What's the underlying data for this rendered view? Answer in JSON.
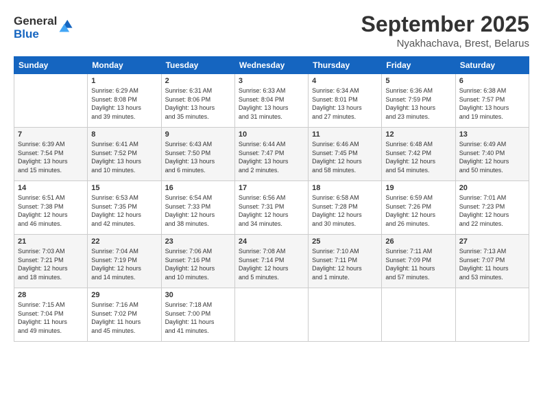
{
  "logo": {
    "general": "General",
    "blue": "Blue"
  },
  "title": "September 2025",
  "location": "Nyakhachava, Brest, Belarus",
  "days_header": [
    "Sunday",
    "Monday",
    "Tuesday",
    "Wednesday",
    "Thursday",
    "Friday",
    "Saturday"
  ],
  "weeks": [
    [
      {
        "day": "",
        "text": ""
      },
      {
        "day": "1",
        "text": "Sunrise: 6:29 AM\nSunset: 8:08 PM\nDaylight: 13 hours\nand 39 minutes."
      },
      {
        "day": "2",
        "text": "Sunrise: 6:31 AM\nSunset: 8:06 PM\nDaylight: 13 hours\nand 35 minutes."
      },
      {
        "day": "3",
        "text": "Sunrise: 6:33 AM\nSunset: 8:04 PM\nDaylight: 13 hours\nand 31 minutes."
      },
      {
        "day": "4",
        "text": "Sunrise: 6:34 AM\nSunset: 8:01 PM\nDaylight: 13 hours\nand 27 minutes."
      },
      {
        "day": "5",
        "text": "Sunrise: 6:36 AM\nSunset: 7:59 PM\nDaylight: 13 hours\nand 23 minutes."
      },
      {
        "day": "6",
        "text": "Sunrise: 6:38 AM\nSunset: 7:57 PM\nDaylight: 13 hours\nand 19 minutes."
      }
    ],
    [
      {
        "day": "7",
        "text": "Sunrise: 6:39 AM\nSunset: 7:54 PM\nDaylight: 13 hours\nand 15 minutes."
      },
      {
        "day": "8",
        "text": "Sunrise: 6:41 AM\nSunset: 7:52 PM\nDaylight: 13 hours\nand 10 minutes."
      },
      {
        "day": "9",
        "text": "Sunrise: 6:43 AM\nSunset: 7:50 PM\nDaylight: 13 hours\nand 6 minutes."
      },
      {
        "day": "10",
        "text": "Sunrise: 6:44 AM\nSunset: 7:47 PM\nDaylight: 13 hours\nand 2 minutes."
      },
      {
        "day": "11",
        "text": "Sunrise: 6:46 AM\nSunset: 7:45 PM\nDaylight: 12 hours\nand 58 minutes."
      },
      {
        "day": "12",
        "text": "Sunrise: 6:48 AM\nSunset: 7:42 PM\nDaylight: 12 hours\nand 54 minutes."
      },
      {
        "day": "13",
        "text": "Sunrise: 6:49 AM\nSunset: 7:40 PM\nDaylight: 12 hours\nand 50 minutes."
      }
    ],
    [
      {
        "day": "14",
        "text": "Sunrise: 6:51 AM\nSunset: 7:38 PM\nDaylight: 12 hours\nand 46 minutes."
      },
      {
        "day": "15",
        "text": "Sunrise: 6:53 AM\nSunset: 7:35 PM\nDaylight: 12 hours\nand 42 minutes."
      },
      {
        "day": "16",
        "text": "Sunrise: 6:54 AM\nSunset: 7:33 PM\nDaylight: 12 hours\nand 38 minutes."
      },
      {
        "day": "17",
        "text": "Sunrise: 6:56 AM\nSunset: 7:31 PM\nDaylight: 12 hours\nand 34 minutes."
      },
      {
        "day": "18",
        "text": "Sunrise: 6:58 AM\nSunset: 7:28 PM\nDaylight: 12 hours\nand 30 minutes."
      },
      {
        "day": "19",
        "text": "Sunrise: 6:59 AM\nSunset: 7:26 PM\nDaylight: 12 hours\nand 26 minutes."
      },
      {
        "day": "20",
        "text": "Sunrise: 7:01 AM\nSunset: 7:23 PM\nDaylight: 12 hours\nand 22 minutes."
      }
    ],
    [
      {
        "day": "21",
        "text": "Sunrise: 7:03 AM\nSunset: 7:21 PM\nDaylight: 12 hours\nand 18 minutes."
      },
      {
        "day": "22",
        "text": "Sunrise: 7:04 AM\nSunset: 7:19 PM\nDaylight: 12 hours\nand 14 minutes."
      },
      {
        "day": "23",
        "text": "Sunrise: 7:06 AM\nSunset: 7:16 PM\nDaylight: 12 hours\nand 10 minutes."
      },
      {
        "day": "24",
        "text": "Sunrise: 7:08 AM\nSunset: 7:14 PM\nDaylight: 12 hours\nand 5 minutes."
      },
      {
        "day": "25",
        "text": "Sunrise: 7:10 AM\nSunset: 7:11 PM\nDaylight: 12 hours\nand 1 minute."
      },
      {
        "day": "26",
        "text": "Sunrise: 7:11 AM\nSunset: 7:09 PM\nDaylight: 11 hours\nand 57 minutes."
      },
      {
        "day": "27",
        "text": "Sunrise: 7:13 AM\nSunset: 7:07 PM\nDaylight: 11 hours\nand 53 minutes."
      }
    ],
    [
      {
        "day": "28",
        "text": "Sunrise: 7:15 AM\nSunset: 7:04 PM\nDaylight: 11 hours\nand 49 minutes."
      },
      {
        "day": "29",
        "text": "Sunrise: 7:16 AM\nSunset: 7:02 PM\nDaylight: 11 hours\nand 45 minutes."
      },
      {
        "day": "30",
        "text": "Sunrise: 7:18 AM\nSunset: 7:00 PM\nDaylight: 11 hours\nand 41 minutes."
      },
      {
        "day": "",
        "text": ""
      },
      {
        "day": "",
        "text": ""
      },
      {
        "day": "",
        "text": ""
      },
      {
        "day": "",
        "text": ""
      }
    ]
  ]
}
